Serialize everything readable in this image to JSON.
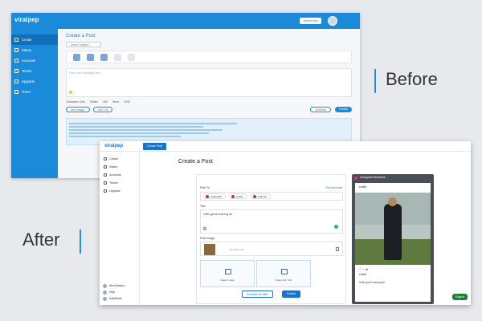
{
  "labels": {
    "before": "Before",
    "after": "After"
  },
  "colors": {
    "accent": "#1a8ad9",
    "after_accent": "#1a73c9",
    "label_bar": "#2a8fd8"
  },
  "before": {
    "logo": "viralpep",
    "nav": [
      "Create",
      "Status",
      "Accounts",
      "Teams",
      "Upgrade",
      "Ticket"
    ],
    "whats_new": "What's New",
    "title": "Create a Post",
    "category_placeholder": "-- Select Category --",
    "message_placeholder": "Enter your message here",
    "char_limit": "Character Limit",
    "limits": [
      "Twitter",
      "280",
      "Store",
      "2200"
    ],
    "buttons": {
      "add_images": "Add Images",
      "add_link": "Add Link",
      "schedule": "Schedule",
      "publish": "Publish"
    }
  },
  "after": {
    "logo": "viralpep",
    "create_post_button": "Create Post",
    "nav": [
      "Create",
      "Status",
      "Accounts",
      "Teams",
      "Upgrade"
    ],
    "side_bottom": [
      "AlexZaleska",
      "Help",
      "KalaRowe"
    ],
    "title": "Create a Post",
    "post_to": "Post To",
    "find_accounts": "Find accounts",
    "chips": [
      "viralpep99",
      "a.dell1",
      "viralchef"
    ],
    "text_label": "Text",
    "text_value": "Hello good morning all",
    "post_image": "Post Image",
    "image_name": "sample name",
    "upload_options": [
      "Select image",
      "Select Gif / Vid"
    ],
    "schedule": "Schedule for later",
    "publish": "Publish",
    "preview_title": "Instagram Business",
    "preview_user": "a.dell1",
    "preview_likes": "a.dell1",
    "preview_caption": "Hello good morning all",
    "support": "Support"
  }
}
